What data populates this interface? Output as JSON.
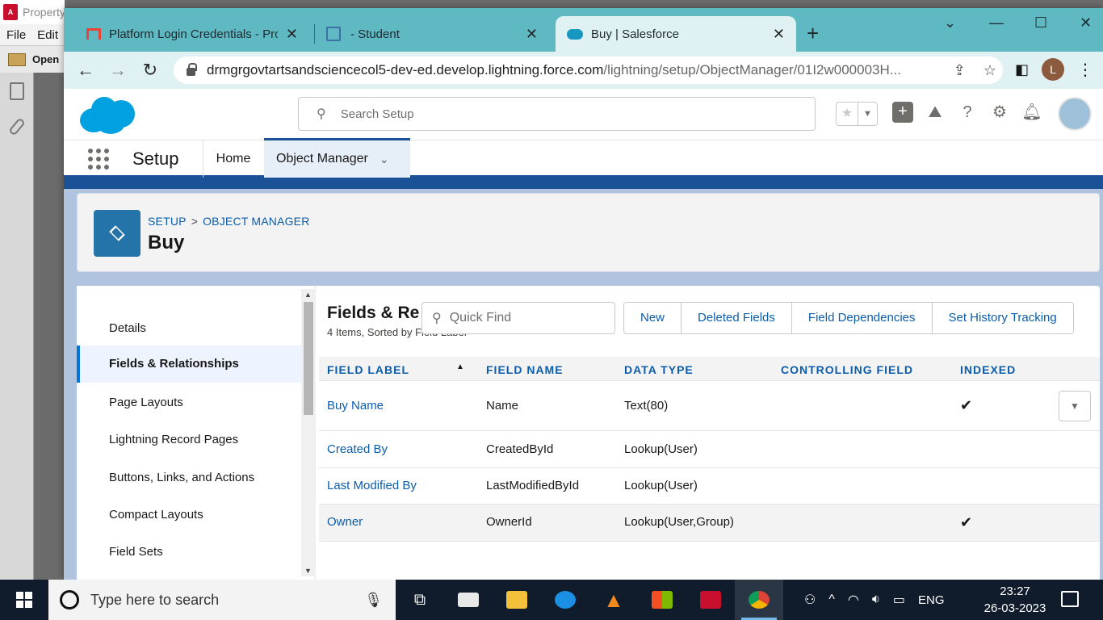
{
  "background_app": {
    "title": "Property",
    "menu": [
      "File",
      "Edit"
    ],
    "toolbar_label": "Open"
  },
  "browser": {
    "tabs": [
      {
        "title": "Platform Login Credentials - Proj",
        "active": false
      },
      {
        "title": "- Student",
        "active": false
      },
      {
        "title": "Buy | Salesforce",
        "active": true
      }
    ],
    "url_host": "drmgrgovtartsandsciencecol5-dev-ed.develop.lightning.force.com",
    "url_path": "/lightning/setup/ObjectManager/01I2w000003H...",
    "profile_initial": "L"
  },
  "sf_header": {
    "search_placeholder": "Search Setup"
  },
  "sf_nav": {
    "app_name": "Setup",
    "home": "Home",
    "object_manager": "Object Manager"
  },
  "object_header": {
    "breadcrumb_setup": "SETUP",
    "breadcrumb_sep": ">",
    "breadcrumb_om": "OBJECT MANAGER",
    "title": "Buy"
  },
  "sidebar": {
    "items": [
      {
        "label": "Details",
        "active": false
      },
      {
        "label": "Fields & Relationships",
        "active": true
      },
      {
        "label": "Page Layouts",
        "active": false
      },
      {
        "label": "Lightning Record Pages",
        "active": false
      },
      {
        "label": "Buttons, Links, and Actions",
        "active": false
      },
      {
        "label": "Compact Layouts",
        "active": false
      },
      {
        "label": "Field Sets",
        "active": false
      }
    ]
  },
  "main": {
    "title": "Fields & Re",
    "subtitle": "4 Items, Sorted by Field Label",
    "quickfind_placeholder": "Quick Find",
    "buttons": [
      "New",
      "Deleted Fields",
      "Field Dependencies",
      "Set History Tracking"
    ],
    "columns": [
      "FIELD LABEL",
      "FIELD NAME",
      "DATA TYPE",
      "CONTROLLING FIELD",
      "INDEXED"
    ],
    "rows": [
      {
        "label": "Buy Name",
        "name": "Name",
        "type": "Text(80)",
        "controlling": "",
        "indexed": true
      },
      {
        "label": "Created By",
        "name": "CreatedById",
        "type": "Lookup(User)",
        "controlling": "",
        "indexed": false
      },
      {
        "label": "Last Modified By",
        "name": "LastModifiedById",
        "type": "Lookup(User)",
        "controlling": "",
        "indexed": false
      },
      {
        "label": "Owner",
        "name": "OwnerId",
        "type": "Lookup(User,Group)",
        "controlling": "",
        "indexed": true
      }
    ]
  },
  "taskbar": {
    "search_placeholder": "Type here to search",
    "language": "ENG",
    "time": "23:27",
    "date": "26-03-2023"
  },
  "colors": {
    "tabstrip": "#5eb9c3",
    "sf_brand": "#00a1e0",
    "link": "#0b5cab",
    "nav_accent": "#1b5297"
  }
}
